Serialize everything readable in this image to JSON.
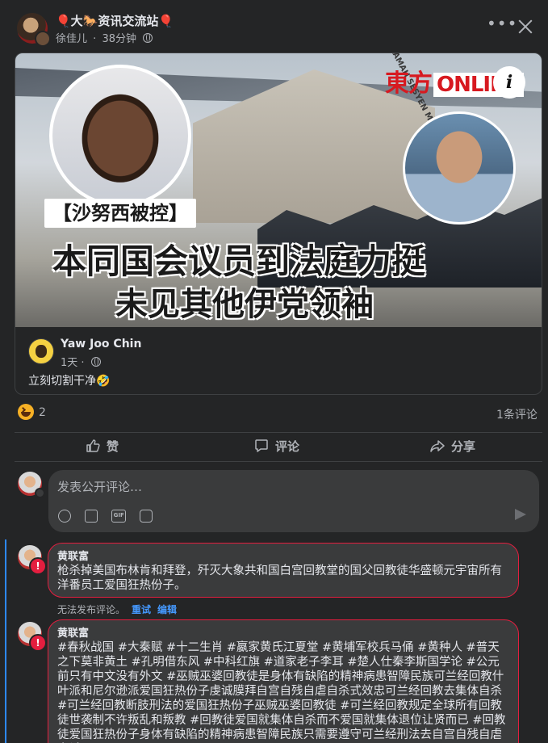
{
  "header": {
    "group_name": "🎈大🐎资讯交流站🎈",
    "author": "徐佳儿",
    "time": "38分钟",
    "separator": "·"
  },
  "shared_post": {
    "image": {
      "brand": "東方",
      "brand_suffix": "ONLINE",
      "tag": "【沙努西被控】",
      "headline_line1": "本同国会议员到法庭力挺",
      "headline_line2": "未见其他伊党领袖",
      "building_sign": "MAHKAMAH SESYEN MAJISTRET SELAYANG"
    },
    "author": "Yaw Joo Chin",
    "time": "1天",
    "text": "立刻切割干净🤣"
  },
  "stats": {
    "reaction_count": "2",
    "comment_count": "1条评论"
  },
  "actions": {
    "like": "赞",
    "comment": "评论",
    "share": "分享"
  },
  "composer": {
    "placeholder": "发表公开评论…",
    "gif_label": "GIF"
  },
  "comments": [
    {
      "author": "黄联富",
      "text": "枪杀掉美国布林肯和拜登，歼灭大象共和国白宫回教堂的国父回教徒华盛顿元宇宙所有洋番员工爱国狂热份子。",
      "status": "无法发布评论。",
      "retry": "重试",
      "edit": "编辑"
    },
    {
      "author": "黄联富",
      "text": "#春秋战国 #大秦赋 #十二生肖 #嬴家黄氏江夏堂 #黄埔军校兵马俑 #黄种人 #普天之下莫非黄土 #孔明借东风 #中科红旗 #道家老子李耳 #楚人仕秦李斯国学论 #公元前只有中文没有外文 #巫贼巫婆回教徒是身体有缺陷的精神病患智障民族可兰经回教什叶派和尼尔逊派爱国狂热份子虔诚膜拜自宫自残自虐自杀式效忠可兰经回教去集体自杀 #可兰经回教断肢刑法的爱国狂热份子巫贼巫婆回教徒 #可兰经回教规定全球所有回教徒世袭制不许叛乱和叛教 #回教徒爱国就集体自杀而不爱国就集体退位让贤而已 #回教徒爱国狂热份子身体有缺陷的精神病患智障民族只需要遵守可兰经刑法去自宫自残自虐自杀"
    }
  ],
  "error_badge": "!"
}
